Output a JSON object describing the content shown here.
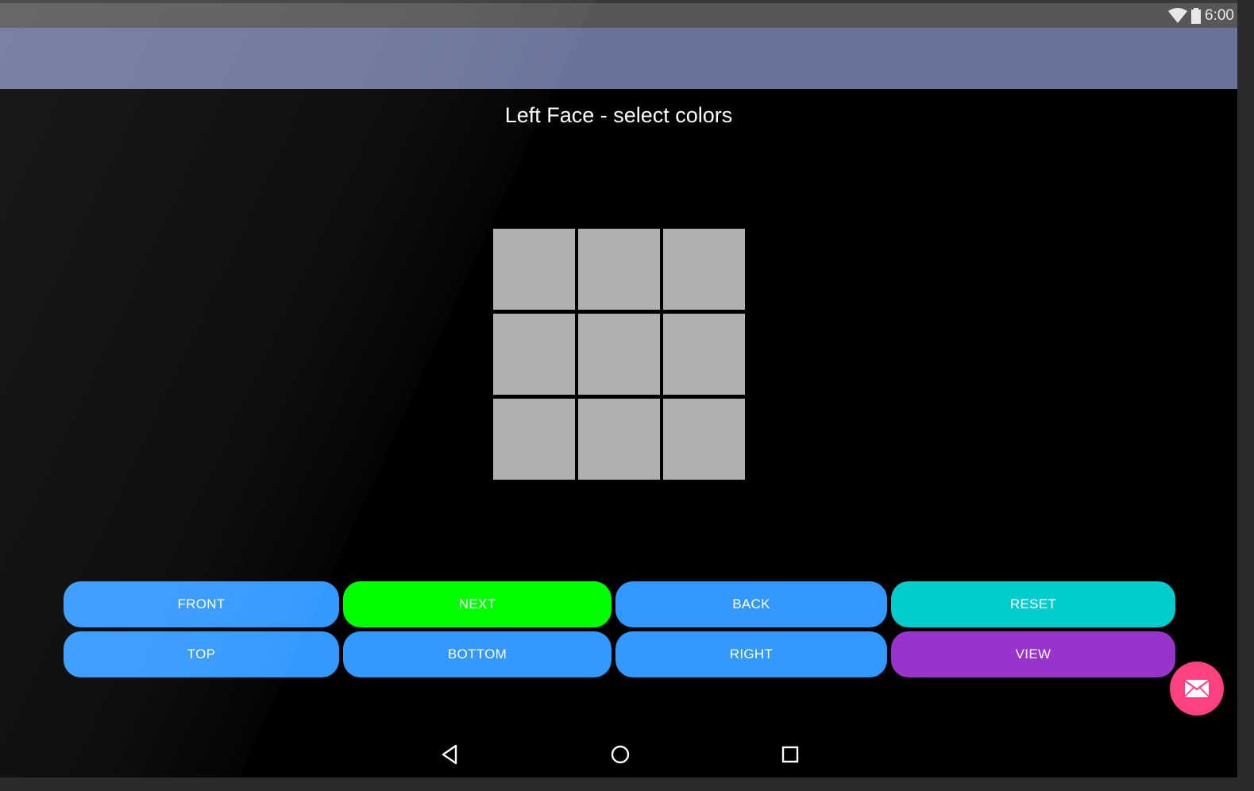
{
  "status_bar": {
    "time": "6:00",
    "wifi_icon": "wifi-icon",
    "battery_icon": "battery-icon"
  },
  "main": {
    "title": "Left Face - select colors"
  },
  "grid": {
    "cells": [
      {
        "color": "#b0b0b0"
      },
      {
        "color": "#b0b0b0"
      },
      {
        "color": "#b0b0b0"
      },
      {
        "color": "#b0b0b0"
      },
      {
        "color": "#b0b0b0"
      },
      {
        "color": "#b0b0b0"
      },
      {
        "color": "#b0b0b0"
      },
      {
        "color": "#b0b0b0"
      },
      {
        "color": "#b0b0b0"
      }
    ]
  },
  "buttons": {
    "front": {
      "label": "FRONT",
      "color": "#3399ff"
    },
    "next": {
      "label": "NEXT",
      "color": "#00ff00"
    },
    "back": {
      "label": "BACK",
      "color": "#3399ff"
    },
    "reset": {
      "label": "RESET",
      "color": "#00cccc"
    },
    "top": {
      "label": "TOP",
      "color": "#3399ff"
    },
    "bottom": {
      "label": "BOTTOM",
      "color": "#3399ff"
    },
    "right": {
      "label": "RIGHT",
      "color": "#3399ff"
    },
    "view": {
      "label": "VIEW",
      "color": "#9933cc"
    }
  },
  "fab": {
    "icon": "mail-icon",
    "color": "#ff4081"
  },
  "nav_bar": {
    "back_icon": "nav-back-icon",
    "home_icon": "nav-home-icon",
    "recents_icon": "nav-recents-icon"
  },
  "theme": {
    "app_bar_color": "#6a739a",
    "status_bar_color": "#575757",
    "background": "#000000"
  }
}
